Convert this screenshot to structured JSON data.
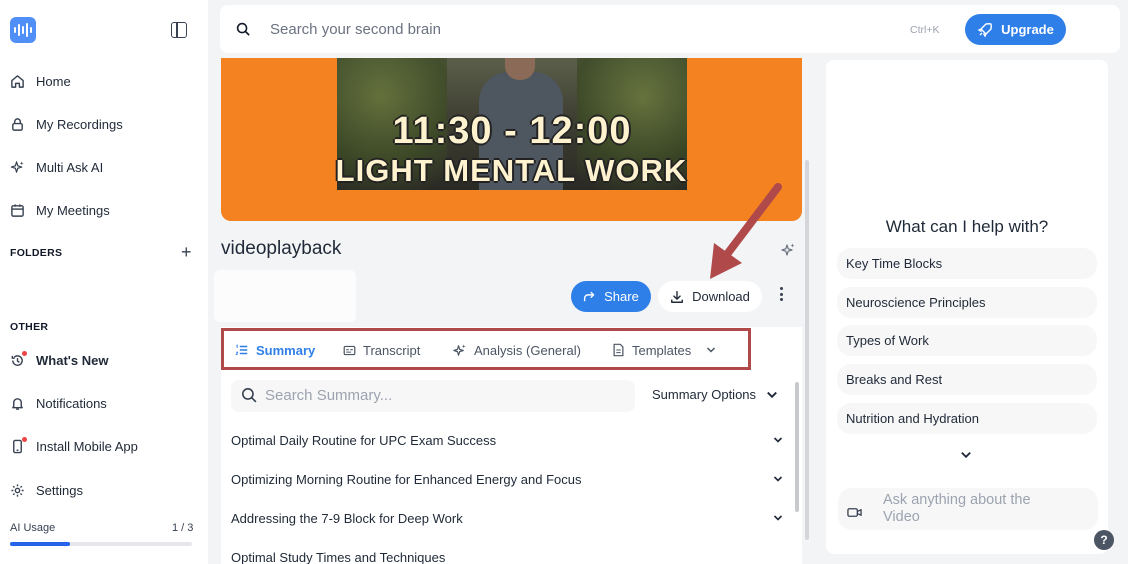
{
  "sidebar": {
    "nav": [
      {
        "label": "Home",
        "icon": "home-icon"
      },
      {
        "label": "My Recordings",
        "icon": "lock-icon"
      },
      {
        "label": "Multi Ask AI",
        "icon": "sparkle-icon"
      },
      {
        "label": "My Meetings",
        "icon": "calendar-icon"
      }
    ],
    "folders_label": "FOLDERS",
    "other_label": "OTHER",
    "other": [
      {
        "label": "What's New",
        "icon": "history-icon",
        "badge": true
      },
      {
        "label": "Notifications",
        "icon": "bell-icon"
      },
      {
        "label": "Install Mobile App",
        "icon": "phone-icon",
        "badge": true
      },
      {
        "label": "Settings",
        "icon": "gear-icon"
      }
    ],
    "usage": {
      "label": "AI Usage",
      "count": "1 / 3",
      "fraction": 0.33
    }
  },
  "topbar": {
    "search_placeholder": "Search your second brain",
    "shortcut": "Ctrl+K",
    "upgrade_label": "Upgrade"
  },
  "video": {
    "overlay_time": "11:30 - 12:00",
    "overlay_caption": "LIGHT MENTAL WORK",
    "title": "videoplayback"
  },
  "actions": {
    "share_label": "Share",
    "download_label": "Download"
  },
  "tabs": [
    {
      "label": "Summary",
      "icon": "list-icon",
      "active": true
    },
    {
      "label": "Transcript",
      "icon": "captions-icon"
    },
    {
      "label": "Analysis (General)",
      "icon": "sparkle-icon"
    },
    {
      "label": "Templates",
      "icon": "document-icon"
    }
  ],
  "summary": {
    "search_placeholder": "Search Summary...",
    "options_label": "Summary Options",
    "items": [
      "Optimal Daily Routine for UPC Exam Success",
      "Optimizing Morning Routine for Enhanced Energy and Focus",
      "Addressing the 7-9 Block for Deep Work",
      "Optimal Study Times and Techniques"
    ]
  },
  "assistant": {
    "title": "What can I help with?",
    "suggestions": [
      "Key Time Blocks",
      "Neuroscience Principles",
      "Types of Work",
      "Breaks and Rest",
      "Nutrition and Hydration"
    ],
    "ask_placeholder": "Ask anything about the Video",
    "help_label": "?"
  },
  "colors": {
    "accent": "#2f7fe8",
    "video_bg": "#f48220",
    "highlight_border": "#b04a4a",
    "badge": "#ef4444"
  }
}
